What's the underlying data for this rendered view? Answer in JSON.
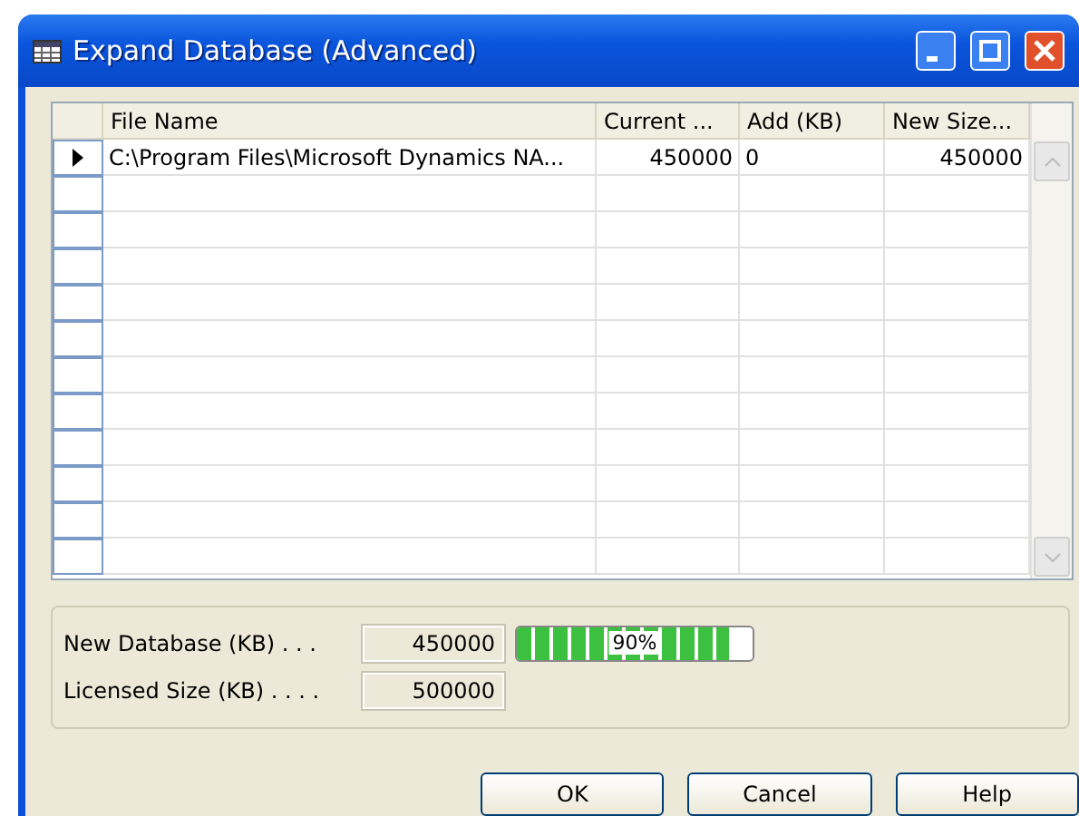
{
  "window": {
    "title": "Expand Database (Advanced)"
  },
  "table": {
    "columns": [
      "File Name",
      "Current ...",
      "Add (KB)",
      "New Size..."
    ],
    "rows": [
      {
        "selected": true,
        "cells": [
          "C:\\Program Files\\Microsoft Dynamics NA...",
          "450000",
          "0",
          "450000"
        ]
      },
      {
        "selected": false,
        "cells": []
      },
      {
        "selected": false,
        "cells": []
      },
      {
        "selected": false,
        "cells": []
      },
      {
        "selected": false,
        "cells": []
      },
      {
        "selected": false,
        "cells": []
      },
      {
        "selected": false,
        "cells": []
      },
      {
        "selected": false,
        "cells": []
      },
      {
        "selected": false,
        "cells": []
      },
      {
        "selected": false,
        "cells": []
      },
      {
        "selected": false,
        "cells": []
      },
      {
        "selected": false,
        "cells": []
      }
    ]
  },
  "summary": [
    {
      "label": "New Database (KB) . . .",
      "value": "450000",
      "progress": {
        "level": 0.9,
        "reading": "90%"
      }
    },
    {
      "label": "Licensed Size (KB) . . . .",
      "value": "500000"
    }
  ],
  "buttons": [
    "OK",
    "Cancel",
    "Help"
  ]
}
